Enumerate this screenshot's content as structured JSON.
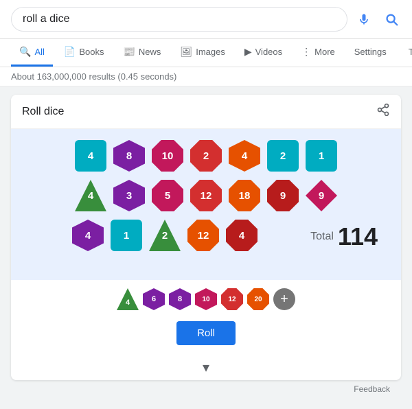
{
  "search": {
    "query": "roll a dice",
    "placeholder": "roll a dice"
  },
  "nav": {
    "tabs": [
      {
        "id": "all",
        "label": "All",
        "icon": "🔍",
        "active": true
      },
      {
        "id": "books",
        "label": "Books",
        "icon": "📄"
      },
      {
        "id": "news",
        "label": "News",
        "icon": "📰"
      },
      {
        "id": "images",
        "label": "Images",
        "icon": "🖼"
      },
      {
        "id": "videos",
        "label": "Videos",
        "icon": "▶"
      },
      {
        "id": "more",
        "label": "More",
        "icon": "⋮"
      }
    ],
    "right_tabs": [
      {
        "label": "Settings"
      },
      {
        "label": "Tools"
      }
    ]
  },
  "results_info": "About 163,000,000 results (0.45 seconds)",
  "dice_card": {
    "title": "Roll dice",
    "total_label": "Total",
    "total_value": "114",
    "roll_button": "Roll",
    "feedback": "Feedback",
    "chevron": "▾"
  },
  "dice_rows": [
    [
      {
        "shape": "square",
        "color": "teal",
        "value": "4"
      },
      {
        "shape": "hex",
        "color": "purple",
        "value": "8"
      },
      {
        "shape": "oct",
        "color": "magenta",
        "value": "10"
      },
      {
        "shape": "oct",
        "color": "red",
        "value": "2"
      },
      {
        "shape": "hex",
        "color": "orange",
        "value": "4"
      },
      {
        "shape": "square",
        "color": "teal",
        "value": "2"
      },
      {
        "shape": "square",
        "color": "teal",
        "value": "1"
      }
    ],
    [
      {
        "shape": "tri",
        "color": "green",
        "value": "4"
      },
      {
        "shape": "hex",
        "color": "purple",
        "value": "3"
      },
      {
        "shape": "oct",
        "color": "magenta",
        "value": "5"
      },
      {
        "shape": "oct",
        "color": "red",
        "value": "12"
      },
      {
        "shape": "oct",
        "color": "orange",
        "value": "18"
      },
      {
        "shape": "oct",
        "color": "dark-red",
        "value": "9"
      },
      {
        "shape": "diamond",
        "color": "magenta",
        "value": "9"
      }
    ],
    [
      {
        "shape": "hex",
        "color": "purple",
        "value": "4"
      },
      {
        "shape": "square",
        "color": "teal",
        "value": "1"
      },
      {
        "shape": "tri",
        "color": "green",
        "value": "2"
      },
      {
        "shape": "oct",
        "color": "orange",
        "value": "12"
      },
      {
        "shape": "oct",
        "color": "dark-red",
        "value": "4"
      }
    ]
  ],
  "die_options": [
    {
      "label": "4",
      "shape": "tri",
      "color": "#388e3c"
    },
    {
      "label": "6",
      "shape": "hex",
      "color": "#7b1fa2"
    },
    {
      "label": "8",
      "shape": "hex",
      "color": "#7b1fa2"
    },
    {
      "label": "10",
      "shape": "hex",
      "color": "#c2185b"
    },
    {
      "label": "12",
      "shape": "oct",
      "color": "#d32f2f"
    },
    {
      "label": "20",
      "shape": "oct",
      "color": "#e65100"
    },
    {
      "label": "+",
      "shape": "circle",
      "color": "#757575"
    }
  ]
}
